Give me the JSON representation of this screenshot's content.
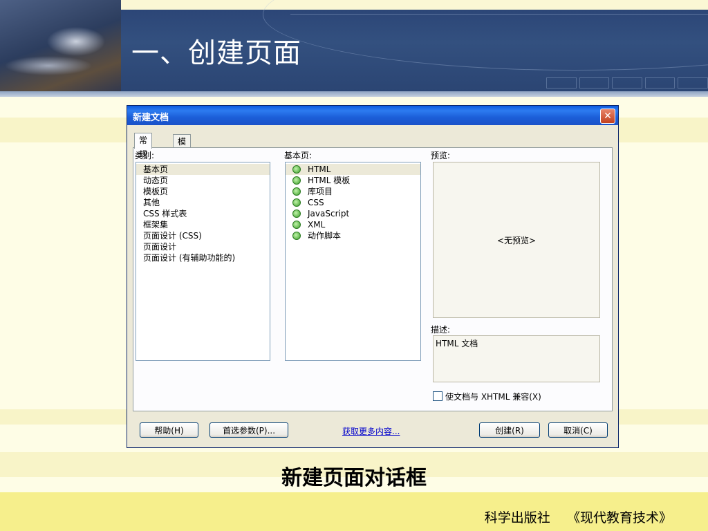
{
  "slide": {
    "title": "一、创建页面",
    "caption": "新建页面对话框",
    "footer": {
      "publisher": "科学出版社",
      "book": "《现代教育技术》"
    }
  },
  "dialog": {
    "title": "新建文档",
    "close_icon": "close-icon",
    "tabs": [
      {
        "label": "常规",
        "active": true
      },
      {
        "label": "模板",
        "active": false
      }
    ],
    "category": {
      "label": "类别:",
      "items": [
        "基本页",
        "动态页",
        "模板页",
        "其他",
        "CSS 样式表",
        "框架集",
        "页面设计 (CSS)",
        "页面设计",
        "页面设计 (有辅助功能的)"
      ],
      "selected": "基本页"
    },
    "basic_page": {
      "label": "基本页:",
      "items": [
        "HTML",
        "HTML 模板",
        "库项目",
        "CSS",
        "JavaScript",
        "XML",
        "动作脚本"
      ],
      "selected": "HTML",
      "item_icon": "page-icon"
    },
    "preview": {
      "label": "预览:",
      "text": "<无预览>"
    },
    "description": {
      "label": "描述:",
      "text": "HTML 文档"
    },
    "xhtml_checkbox": {
      "label": "使文档与 XHTML 兼容(X)",
      "checked": false
    },
    "buttons": {
      "help": "帮助(H)",
      "preferences": "首选参数(P)...",
      "get_more": "获取更多内容...",
      "create": "创建(R)",
      "cancel": "取消(C)"
    }
  },
  "colors": {
    "header_navy": "#2c4677",
    "background_cream": "#fefde6",
    "footer_yellow": "#f6ef8c",
    "titlebar_blue": "#1b5ed8",
    "close_red": "#c2401e",
    "link_blue": "#0000cc"
  }
}
